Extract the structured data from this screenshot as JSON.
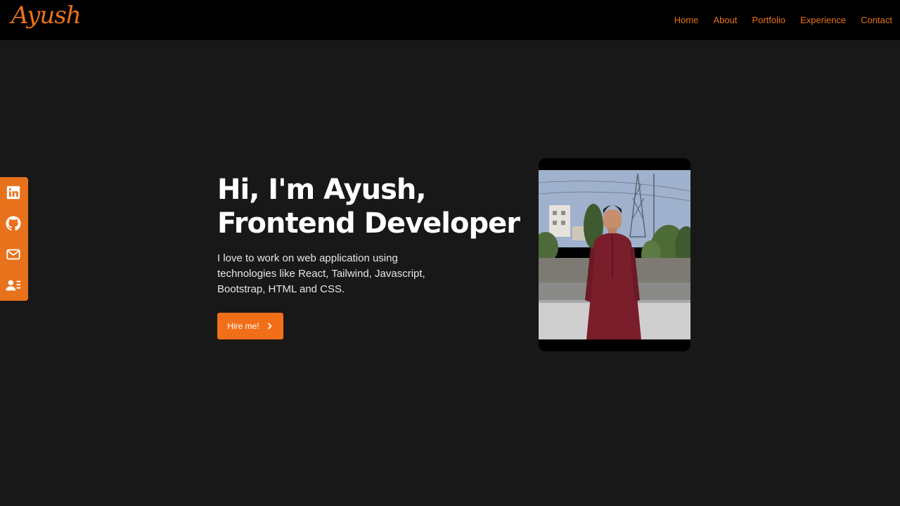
{
  "brand": {
    "logo_text": "Ayush"
  },
  "nav": {
    "items": [
      {
        "label": "Home"
      },
      {
        "label": "About"
      },
      {
        "label": "Portfolio"
      },
      {
        "label": "Experience"
      },
      {
        "label": "Contact"
      }
    ]
  },
  "social": {
    "icons": [
      "linkedin-icon",
      "github-icon",
      "mail-icon",
      "resume-icon"
    ]
  },
  "hero": {
    "heading_line1": "Hi, I'm Ayush,",
    "heading_line2": "Frontend Developer",
    "intro": "I love to work on web application using technologies like React, Tailwind, Javascript, Bootstrap, HTML and CSS.",
    "hire_label": "Hire me!"
  },
  "colors": {
    "accent": "#e8721c",
    "button": "#f26f19",
    "page_background": "#181818",
    "navbar_background": "#000000"
  }
}
